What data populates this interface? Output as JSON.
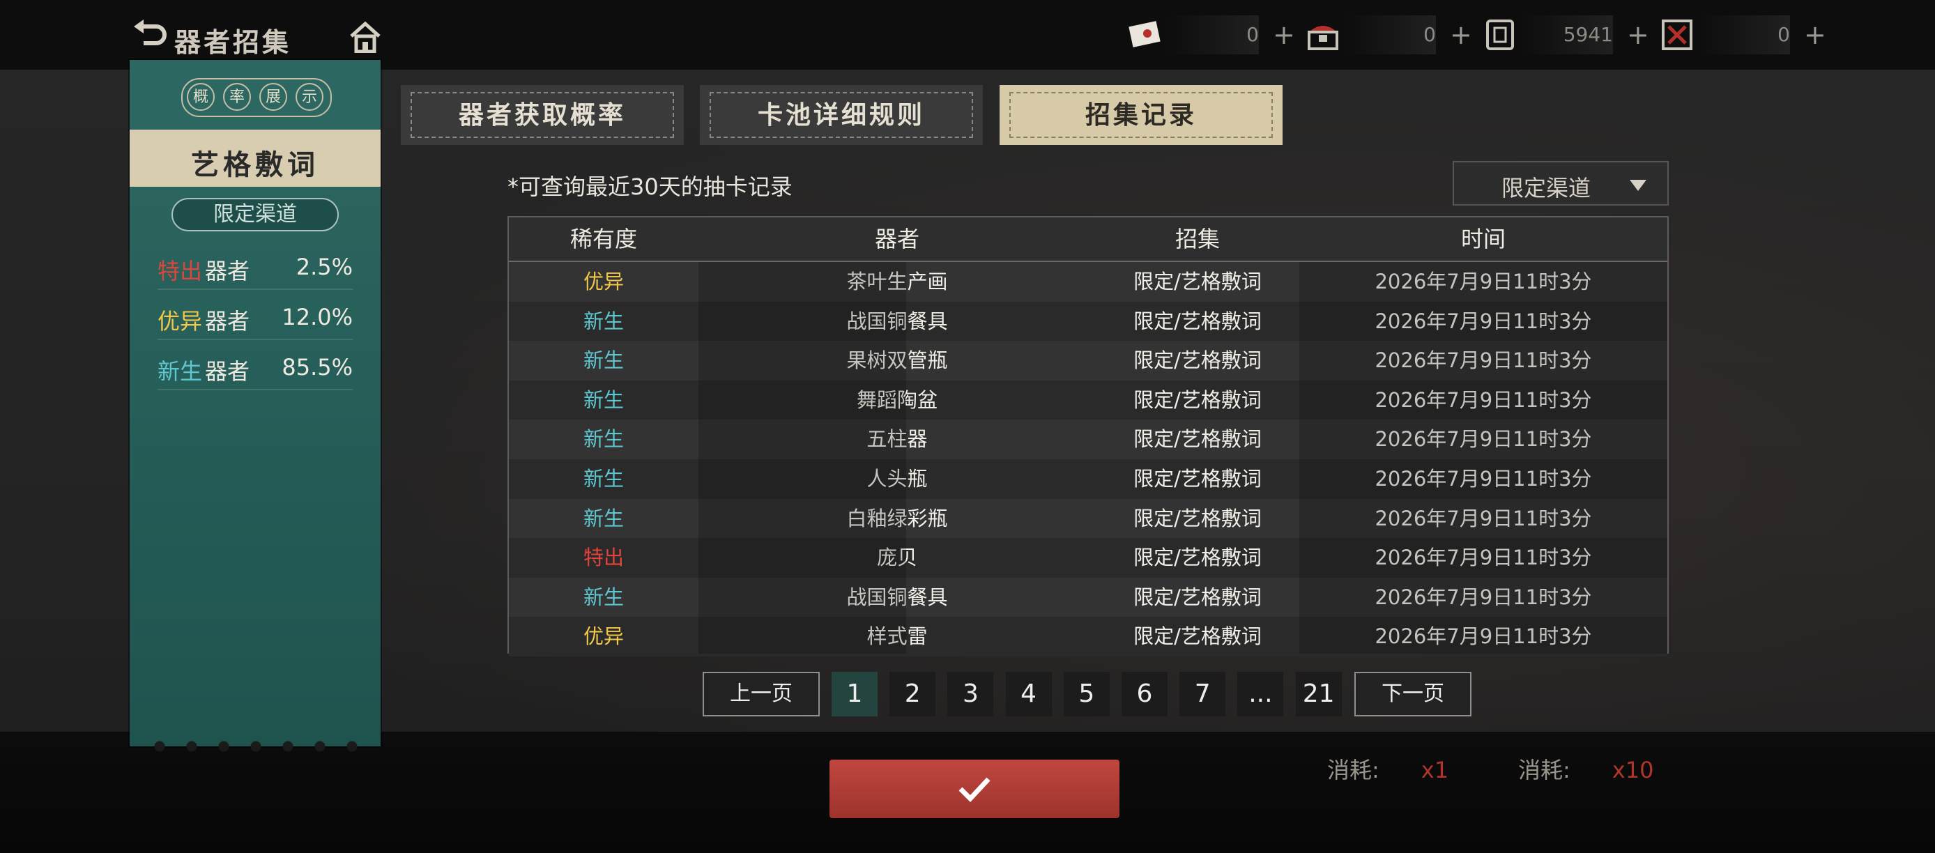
{
  "header": {
    "title": "器者招集",
    "resources": [
      {
        "icon": "envelope-ticket-icon",
        "value": "0"
      },
      {
        "icon": "chest-icon",
        "value": "0"
      },
      {
        "icon": "coin-icon",
        "value": "5941"
      },
      {
        "icon": "gem-envelope-icon",
        "value": "0"
      }
    ]
  },
  "sidebar": {
    "badge_chars": [
      "概",
      "率",
      "展",
      "示"
    ],
    "pool_name": "艺格敷词",
    "channel": "限定渠道",
    "rates": [
      {
        "tag": "特出",
        "tag_color": "#e0453c",
        "label": "器者",
        "pct": "2.5%"
      },
      {
        "tag": "优异",
        "tag_color": "#f2c84b",
        "label": "器者",
        "pct": "12.0%"
      },
      {
        "tag": "新生",
        "tag_color": "#5ec6cf",
        "label": "器者",
        "pct": "85.5%"
      }
    ]
  },
  "tabs": [
    {
      "label": "器者获取概率",
      "active": false
    },
    {
      "label": "卡池详细规则",
      "active": false
    },
    {
      "label": "招集记录",
      "active": true
    }
  ],
  "record": {
    "note": "*可查询最近30天的抽卡记录",
    "filter": "限定渠道",
    "columns": [
      "稀有度",
      "器者",
      "招集",
      "时间"
    ],
    "rows": [
      {
        "rarity": "优异",
        "color": "#f2c84b",
        "item": "茶叶生产画",
        "pool": "限定/艺格敷词",
        "time": "2026年7月9日11时3分"
      },
      {
        "rarity": "新生",
        "color": "#5ec6cf",
        "item": "战国铜餐具",
        "pool": "限定/艺格敷词",
        "time": "2026年7月9日11时3分"
      },
      {
        "rarity": "新生",
        "color": "#5ec6cf",
        "item": "果树双管瓶",
        "pool": "限定/艺格敷词",
        "time": "2026年7月9日11时3分"
      },
      {
        "rarity": "新生",
        "color": "#5ec6cf",
        "item": "舞蹈陶盆",
        "pool": "限定/艺格敷词",
        "time": "2026年7月9日11时3分"
      },
      {
        "rarity": "新生",
        "color": "#5ec6cf",
        "item": "五柱器",
        "pool": "限定/艺格敷词",
        "time": "2026年7月9日11时3分"
      },
      {
        "rarity": "新生",
        "color": "#5ec6cf",
        "item": "人头瓶",
        "pool": "限定/艺格敷词",
        "time": "2026年7月9日11时3分"
      },
      {
        "rarity": "新生",
        "color": "#5ec6cf",
        "item": "白釉绿彩瓶",
        "pool": "限定/艺格敷词",
        "time": "2026年7月9日11时3分"
      },
      {
        "rarity": "特出",
        "color": "#e0453c",
        "item": "庞贝",
        "pool": "限定/艺格敷词",
        "time": "2026年7月9日11时3分"
      },
      {
        "rarity": "新生",
        "color": "#5ec6cf",
        "item": "战国铜餐具",
        "pool": "限定/艺格敷词",
        "time": "2026年7月9日11时3分"
      },
      {
        "rarity": "优异",
        "color": "#f2c84b",
        "item": "样式雷",
        "pool": "限定/艺格敷词",
        "time": "2026年7月9日11时3分"
      }
    ]
  },
  "pagination": {
    "prev": "上一页",
    "next": "下一页",
    "pages": [
      "1",
      "2",
      "3",
      "4",
      "5",
      "6",
      "7",
      "...",
      "21"
    ],
    "current": "1"
  },
  "footer": {
    "cost_label": "消耗:",
    "cost_single": "x1",
    "cost_ten": "x10"
  }
}
